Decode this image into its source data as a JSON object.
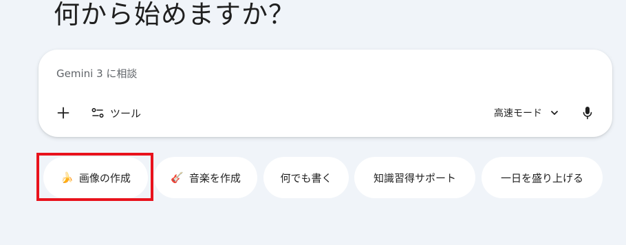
{
  "headline": "何から始めますか？",
  "prompt": {
    "placeholder": "Gemini 3 に相談",
    "value": "",
    "tools_label": "ツール",
    "model_label": "高速モード"
  },
  "chips": [
    {
      "emoji": "🍌",
      "label": "画像の作成"
    },
    {
      "emoji": "🎸",
      "label": "音楽を作成"
    },
    {
      "label": "何でも書く"
    },
    {
      "label": "知識習得サポート"
    },
    {
      "label": "一日を盛り上げる"
    }
  ],
  "highlight_color": "#e8121c",
  "icons": {
    "add": "plus-icon",
    "tools": "tools-icon",
    "model_dropdown": "chevron-down-icon",
    "voice": "microphone-icon"
  }
}
